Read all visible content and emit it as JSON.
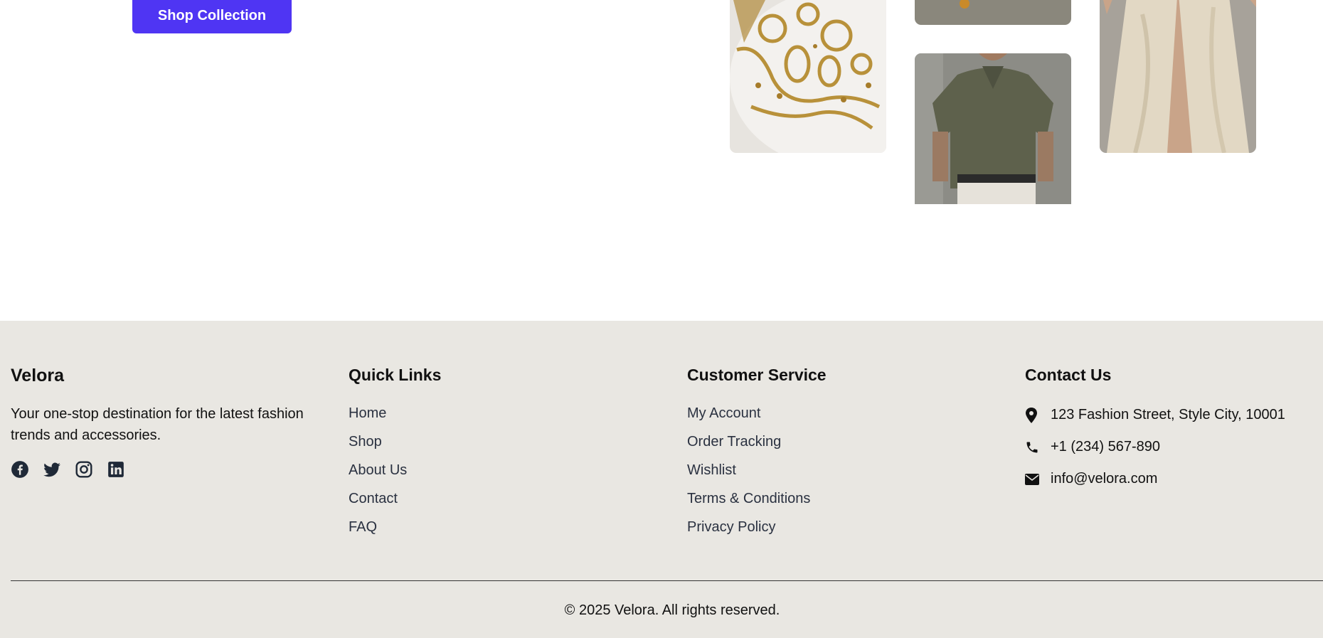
{
  "hero": {
    "cta_label": "Shop Collection"
  },
  "footer": {
    "brand": {
      "name": "Velora",
      "about": "Your one-stop destination for the latest fashion trends and accessories.",
      "socials": [
        "facebook-icon",
        "twitter-icon",
        "instagram-icon",
        "linkedin-icon"
      ]
    },
    "quick_links": {
      "title": "Quick Links",
      "items": [
        "Home",
        "Shop",
        "About Us",
        "Contact",
        "FAQ"
      ]
    },
    "customer_service": {
      "title": "Customer Service",
      "items": [
        "My Account",
        "Order Tracking",
        "Wishlist",
        "Terms & Conditions",
        "Privacy Policy"
      ]
    },
    "contact": {
      "title": "Contact Us",
      "address": "123 Fashion Street, Style City, 10001",
      "phone": "+1 (234) 567-890",
      "email": "info@velora.com"
    },
    "copyright": "© 2025 Velora. All rights reserved."
  },
  "colors": {
    "accent": "#4f35f3",
    "footer_bg": "#e9e7e2",
    "link_text": "#2a3140"
  }
}
